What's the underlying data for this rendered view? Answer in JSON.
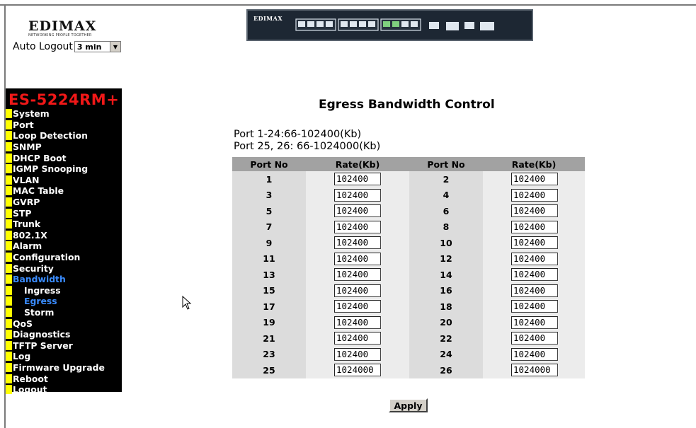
{
  "header": {
    "logo_text": "EDIMAX",
    "logo_tagline": "NETWORKING PEOPLE TOGETHER",
    "auto_logout_label": "Auto Logout",
    "auto_logout_value": "3 min",
    "device_brand": "EDIMAX"
  },
  "sidebar": {
    "model": "ES-5224RM+",
    "items": [
      {
        "label": "System",
        "sub": false,
        "active": false
      },
      {
        "label": "Port",
        "sub": false,
        "active": false
      },
      {
        "label": "Loop Detection",
        "sub": false,
        "active": false
      },
      {
        "label": "SNMP",
        "sub": false,
        "active": false
      },
      {
        "label": "DHCP Boot",
        "sub": false,
        "active": false
      },
      {
        "label": "IGMP Snooping",
        "sub": false,
        "active": false
      },
      {
        "label": "VLAN",
        "sub": false,
        "active": false
      },
      {
        "label": "MAC Table",
        "sub": false,
        "active": false
      },
      {
        "label": "GVRP",
        "sub": false,
        "active": false
      },
      {
        "label": "STP",
        "sub": false,
        "active": false
      },
      {
        "label": "Trunk",
        "sub": false,
        "active": false
      },
      {
        "label": "802.1X",
        "sub": false,
        "active": false
      },
      {
        "label": "Alarm",
        "sub": false,
        "active": false
      },
      {
        "label": "Configuration",
        "sub": false,
        "active": false
      },
      {
        "label": "Security",
        "sub": false,
        "active": false
      },
      {
        "label": "Bandwidth",
        "sub": false,
        "active": true
      },
      {
        "label": "Ingress",
        "sub": true,
        "active": false
      },
      {
        "label": "Egress",
        "sub": true,
        "active": true
      },
      {
        "label": "Storm",
        "sub": true,
        "active": false
      },
      {
        "label": "QoS",
        "sub": false,
        "active": false
      },
      {
        "label": "Diagnostics",
        "sub": false,
        "active": false
      },
      {
        "label": "TFTP Server",
        "sub": false,
        "active": false
      },
      {
        "label": "Log",
        "sub": false,
        "active": false
      },
      {
        "label": "Firmware Upgrade",
        "sub": false,
        "active": false
      },
      {
        "label": "Reboot",
        "sub": false,
        "active": false
      },
      {
        "label": "Logout",
        "sub": false,
        "active": false
      }
    ]
  },
  "main": {
    "title": "Egress Bandwidth Control",
    "range_line1": "Port 1-24:66-102400(Kb)",
    "range_line2": "Port 25, 26: 66-1024000(Kb)",
    "headers": [
      "Port No",
      "Rate(Kb)",
      "Port No",
      "Rate(Kb)"
    ],
    "rows": [
      {
        "p1": "1",
        "r1": "102400",
        "p2": "2",
        "r2": "102400"
      },
      {
        "p1": "3",
        "r1": "102400",
        "p2": "4",
        "r2": "102400"
      },
      {
        "p1": "5",
        "r1": "102400",
        "p2": "6",
        "r2": "102400"
      },
      {
        "p1": "7",
        "r1": "102400",
        "p2": "8",
        "r2": "102400"
      },
      {
        "p1": "9",
        "r1": "102400",
        "p2": "10",
        "r2": "102400"
      },
      {
        "p1": "11",
        "r1": "102400",
        "p2": "12",
        "r2": "102400"
      },
      {
        "p1": "13",
        "r1": "102400",
        "p2": "14",
        "r2": "102400"
      },
      {
        "p1": "15",
        "r1": "102400",
        "p2": "16",
        "r2": "102400"
      },
      {
        "p1": "17",
        "r1": "102400",
        "p2": "18",
        "r2": "102400"
      },
      {
        "p1": "19",
        "r1": "102400",
        "p2": "20",
        "r2": "102400"
      },
      {
        "p1": "21",
        "r1": "102400",
        "p2": "22",
        "r2": "102400"
      },
      {
        "p1": "23",
        "r1": "102400",
        "p2": "24",
        "r2": "102400"
      },
      {
        "p1": "25",
        "r1": "1024000",
        "p2": "26",
        "r2": "1024000"
      }
    ],
    "apply_label": "Apply"
  },
  "colors": {
    "sidebar_bg": "#000000",
    "model_red": "#f01818",
    "menu_marker": "#ffff00",
    "active_blue": "#3a8cff",
    "header_cell": "#a2a2a2"
  }
}
